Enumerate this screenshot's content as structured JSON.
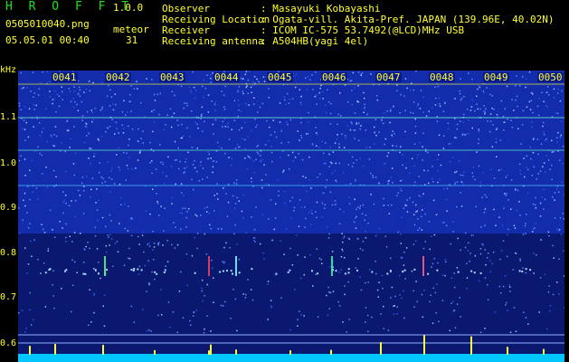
{
  "app": {
    "name": "H R O F F T",
    "version": "1.0.0"
  },
  "file": {
    "name": "0505010040.png",
    "datetime": "05.05.01 00:40"
  },
  "meteor": {
    "label": "meteor",
    "count": "31"
  },
  "info": [
    {
      "key": "Observer",
      "value": ": Masayuki Kobayashi"
    },
    {
      "key": "Receiving Location",
      "value": ": Ogata-vill. Akita-Pref. JAPAN (139.96E, 40.02N)"
    },
    {
      "key": "Receiver",
      "value": ": ICOM IC-575 53.7492(@LCD)MHz USB"
    },
    {
      "key": "Receiving antenna",
      "value": ": A504HB(yagi 4el)"
    }
  ],
  "axis": {
    "y_unit": "kHz",
    "y_ticks": [
      "1.1",
      "1.0",
      "0.9",
      "0.8",
      "0.7",
      "0.6"
    ],
    "x_ticks": [
      "0041",
      "0042",
      "0043",
      "0044",
      "0045",
      "0046",
      "0047",
      "0048",
      "0049",
      "0050"
    ]
  },
  "colors": {
    "background": "#0a1a8a",
    "header_text": "#20e020",
    "label_text": "#ffff30",
    "noise_floor": "#00c8ff"
  }
}
